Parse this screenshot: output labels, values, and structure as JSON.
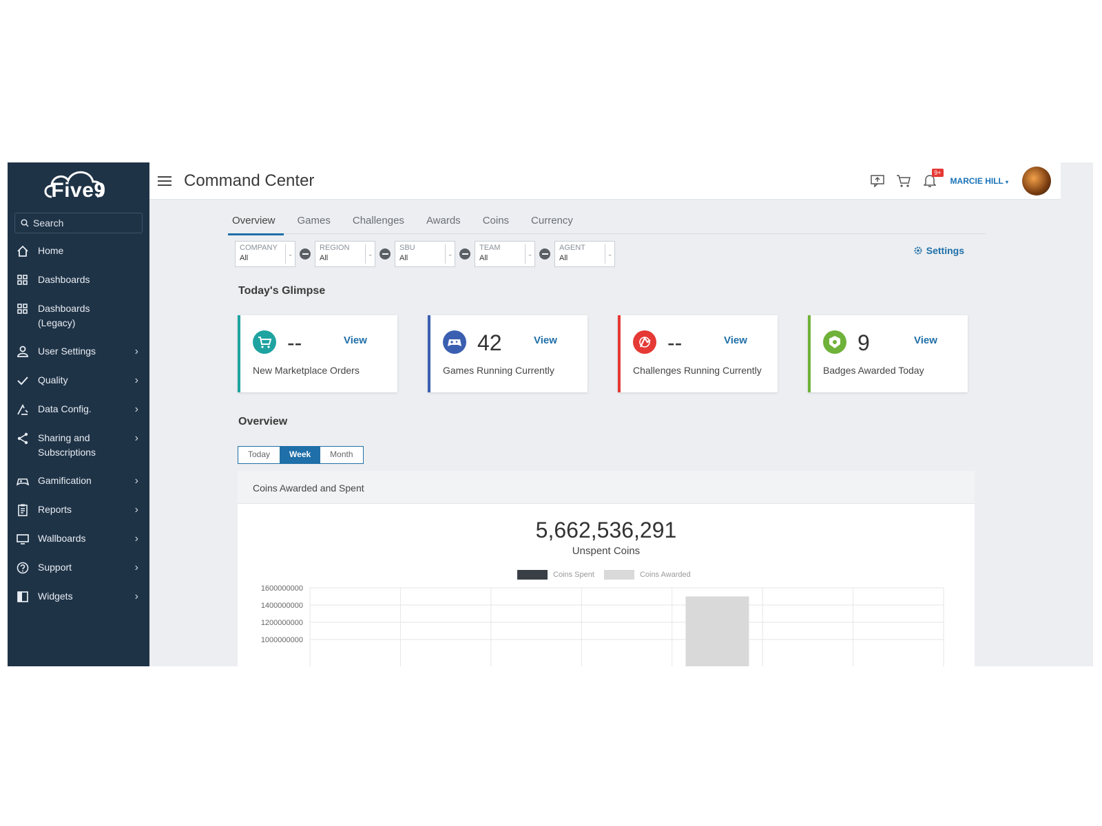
{
  "app": {
    "logo_text": "Five9",
    "title": "Command Center"
  },
  "sidebar": {
    "search_label": "Search",
    "items": [
      {
        "label": "Home",
        "icon": "home-icon",
        "chevron": false
      },
      {
        "label": "Dashboards",
        "icon": "grid-icon",
        "chevron": false
      },
      {
        "label": "Dashboards (Legacy)",
        "icon": "grid-icon",
        "chevron": false
      },
      {
        "label": "User Settings",
        "icon": "user-icon",
        "chevron": true
      },
      {
        "label": "Quality",
        "icon": "check-icon",
        "chevron": true
      },
      {
        "label": "Data Config.",
        "icon": "data-config-icon",
        "chevron": true
      },
      {
        "label": "Sharing and Subscriptions",
        "icon": "share-icon",
        "chevron": true
      },
      {
        "label": "Gamification",
        "icon": "gamepad-icon",
        "chevron": true
      },
      {
        "label": "Reports",
        "icon": "clipboard-icon",
        "chevron": true
      },
      {
        "label": "Wallboards",
        "icon": "monitor-icon",
        "chevron": true
      },
      {
        "label": "Support",
        "icon": "help-icon",
        "chevron": true
      },
      {
        "label": "Widgets",
        "icon": "widget-icon",
        "chevron": true
      }
    ]
  },
  "topbar": {
    "notification_count": "9+",
    "user_name": "MARCIE HILL"
  },
  "tabs": [
    "Overview",
    "Games",
    "Challenges",
    "Awards",
    "Coins",
    "Currency"
  ],
  "filters": [
    {
      "label": "COMPANY",
      "value": "All"
    },
    {
      "label": "REGION",
      "value": "All"
    },
    {
      "label": "SBU",
      "value": "All"
    },
    {
      "label": "TEAM",
      "value": "All"
    },
    {
      "label": "AGENT",
      "value": "All"
    }
  ],
  "settings_label": "Settings",
  "glimpse": {
    "title": "Today's Glimpse",
    "cards": [
      {
        "value": "--",
        "view": "View",
        "label": "New Marketplace Orders",
        "color": "#1fa3a1",
        "icon": "cart-icon"
      },
      {
        "value": "42",
        "view": "View",
        "label": "Games Running Currently",
        "color": "#3b5fb0",
        "icon": "gamepad-icon"
      },
      {
        "value": "--",
        "view": "View",
        "label": "Challenges Running Currently",
        "color": "#e53935",
        "icon": "challenge-icon"
      },
      {
        "value": "9",
        "view": "View",
        "label": "Badges Awarded Today",
        "color": "#6fb23a",
        "icon": "badge-icon"
      }
    ]
  },
  "overview": {
    "title": "Overview",
    "periods": [
      "Today",
      "Week",
      "Month"
    ],
    "active_period": "Week",
    "panel_title": "Coins Awarded and Spent",
    "unspent_value": "5,662,536,291",
    "unspent_label": "Unspent Coins"
  },
  "chart_data": {
    "type": "bar",
    "series": [
      {
        "name": "Coins Spent",
        "color": "#3a3f45",
        "values": [
          0,
          0,
          0,
          0,
          0,
          0,
          0
        ]
      },
      {
        "name": "Coins Awarded",
        "color": "#d9d9d9",
        "values": [
          0,
          0,
          0,
          0,
          1500000000,
          0,
          0
        ]
      }
    ],
    "yticks": [
      "1600000000",
      "1400000000",
      "1200000000",
      "1000000000"
    ],
    "ylim": [
      0,
      1600000000
    ]
  }
}
